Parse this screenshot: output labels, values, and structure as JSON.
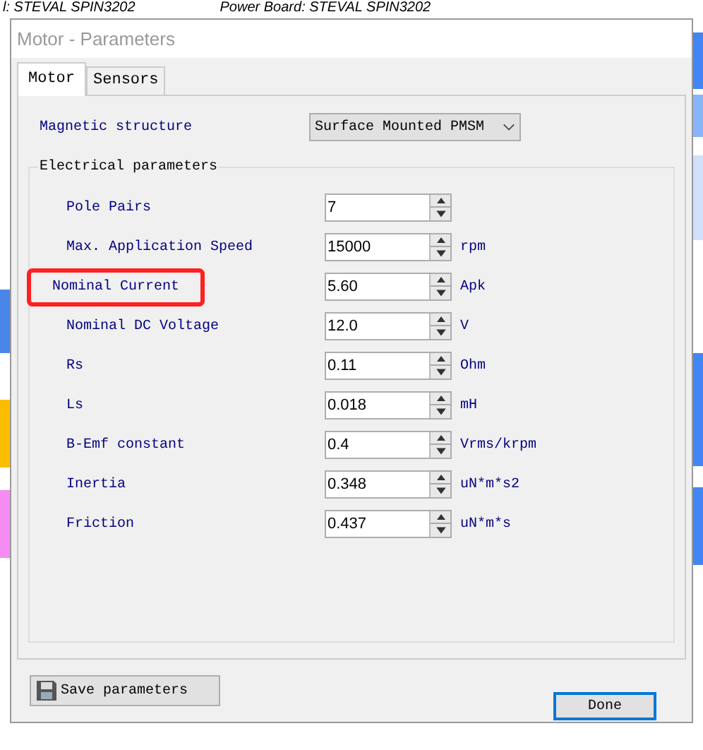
{
  "background_app": {
    "texts": [
      "l: STEVAL SPIN3202",
      "Power Board: STEVAL SPIN3202"
    ]
  },
  "window": {
    "title": "Motor - Parameters"
  },
  "tabs": [
    {
      "label": "Motor",
      "selected": true
    },
    {
      "label": "Sensors",
      "selected": false
    }
  ],
  "magnetic_structure": {
    "label": "Magnetic structure",
    "value": "Surface Mounted PMSM"
  },
  "electrical_parameters": {
    "title": "Electrical parameters",
    "rows": [
      {
        "label": "Pole Pairs",
        "value": "7",
        "unit": "",
        "highlighted": false
      },
      {
        "label": "Max. Application Speed",
        "value": "15000",
        "unit": "rpm",
        "highlighted": false
      },
      {
        "label": "Nominal Current",
        "value": "5.60",
        "unit": "Apk",
        "highlighted": true
      },
      {
        "label": "Nominal DC Voltage",
        "value": "12.0",
        "unit": "V",
        "highlighted": false
      },
      {
        "label": "Rs",
        "value": "0.11",
        "unit": "Ohm",
        "highlighted": false
      },
      {
        "label": "Ls",
        "value": "0.018",
        "unit": "mH",
        "highlighted": false
      },
      {
        "label": "B-Emf constant",
        "value": "0.4",
        "unit": "Vrms/krpm",
        "highlighted": false
      },
      {
        "label": "Inertia",
        "value": "0.348",
        "unit": "uN*m*s2",
        "highlighted": false
      },
      {
        "label": "Friction",
        "value": "0.437",
        "unit": "uN*m*s",
        "highlighted": false
      }
    ]
  },
  "buttons": {
    "save": "Save parameters",
    "done": "Done"
  }
}
